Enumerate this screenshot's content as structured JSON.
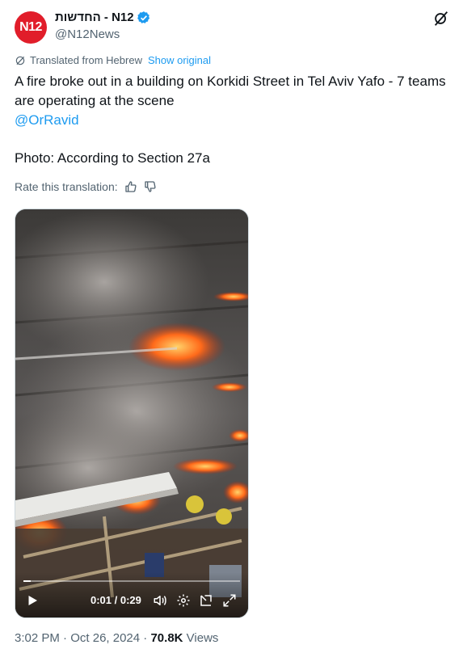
{
  "author": {
    "display_name": "החדשות - N12",
    "handle": "@N12News",
    "avatar_text": "N12"
  },
  "translation": {
    "notice": "Translated from Hebrew",
    "show_original": "Show original",
    "rate_label": "Rate this translation:"
  },
  "tweet": {
    "text": "A fire broke out in a building on Korkidi Street in Tel Aviv Yafo - 7 teams are operating at the scene",
    "mention": "@OrRavid",
    "photo_credit": "Photo: According to Section 27a"
  },
  "video": {
    "time": "0:01 / 0:29",
    "progress": 0.034
  },
  "meta": {
    "time": "3:02 PM",
    "separator": "·",
    "date": "Oct 26, 2024",
    "views_count": "70.8K",
    "views_label": "Views"
  },
  "colors": {
    "accent": "#1d9bf0",
    "brand_red": "#e11d2a",
    "muted_text": "#536471"
  }
}
